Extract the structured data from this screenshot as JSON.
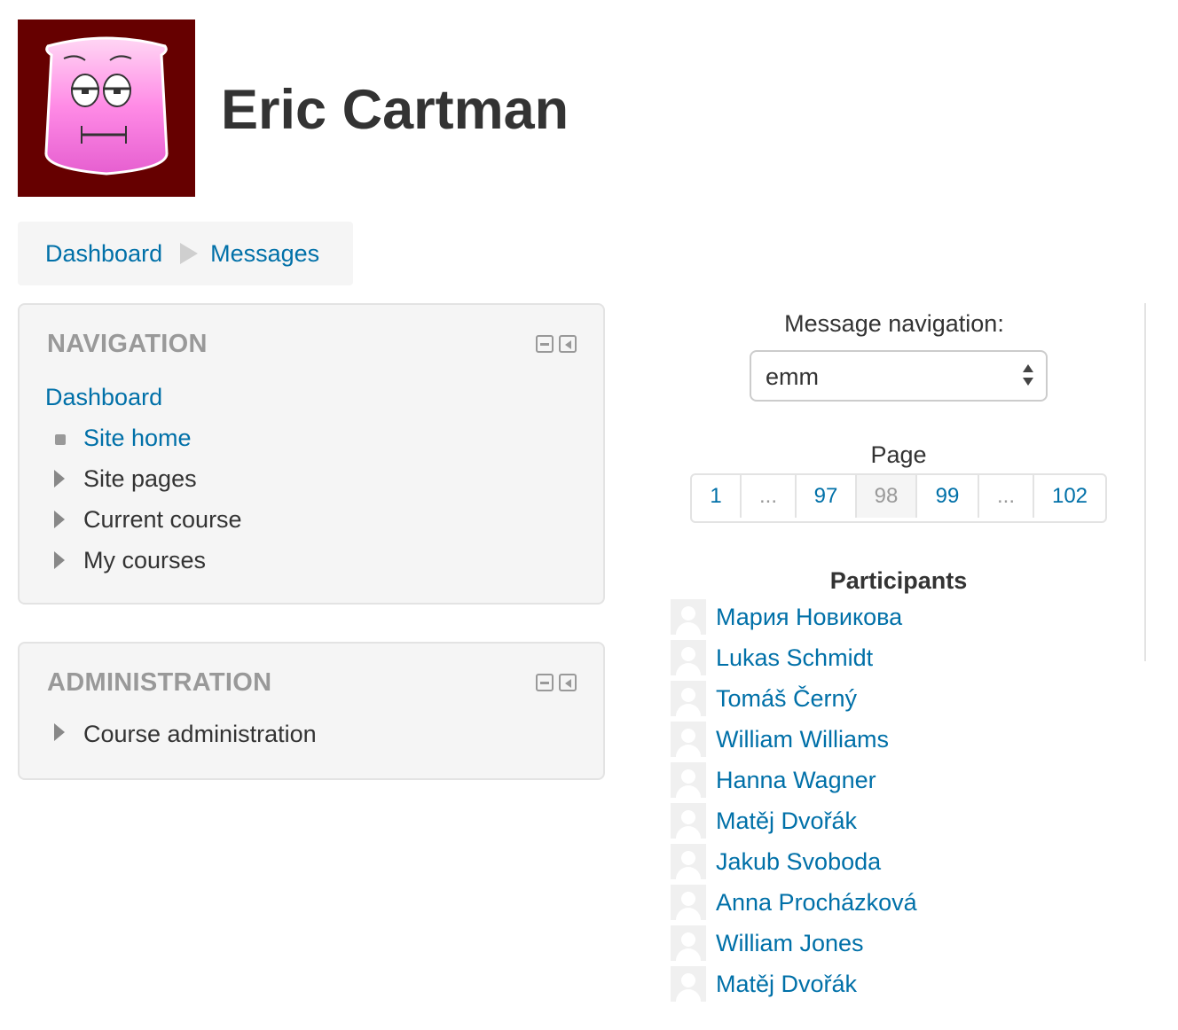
{
  "header": {
    "user_name": "Eric Cartman",
    "avatar_color": "#660000"
  },
  "breadcrumb": {
    "items": [
      "Dashboard",
      "Messages"
    ]
  },
  "navigation_block": {
    "title": "NAVIGATION",
    "root": "Dashboard",
    "items": [
      {
        "label": "Site home",
        "type": "leaf"
      },
      {
        "label": "Site pages",
        "type": "collapsed"
      },
      {
        "label": "Current course",
        "type": "collapsed"
      },
      {
        "label": "My courses",
        "type": "collapsed"
      }
    ]
  },
  "administration_block": {
    "title": "ADMINISTRATION",
    "items": [
      {
        "label": "Course administration",
        "type": "collapsed"
      }
    ]
  },
  "message_navigation": {
    "label": "Message navigation:",
    "selected": "emm"
  },
  "pagination": {
    "label": "Page",
    "pages": [
      "1",
      "...",
      "97",
      "98",
      "99",
      "...",
      "102"
    ],
    "current": "98"
  },
  "participants": {
    "title": "Participants",
    "list": [
      "Мария Новикова",
      "Lukas Schmidt",
      "Tomáš Černý",
      "William Williams",
      "Hanna Wagner",
      "Matěj Dvořák",
      "Jakub Svoboda",
      "Anna Procházková",
      "William Jones",
      "Matěj Dvořák"
    ]
  },
  "colors": {
    "link": "#0070a8",
    "block_bg": "#f5f5f5",
    "muted": "#999999"
  }
}
